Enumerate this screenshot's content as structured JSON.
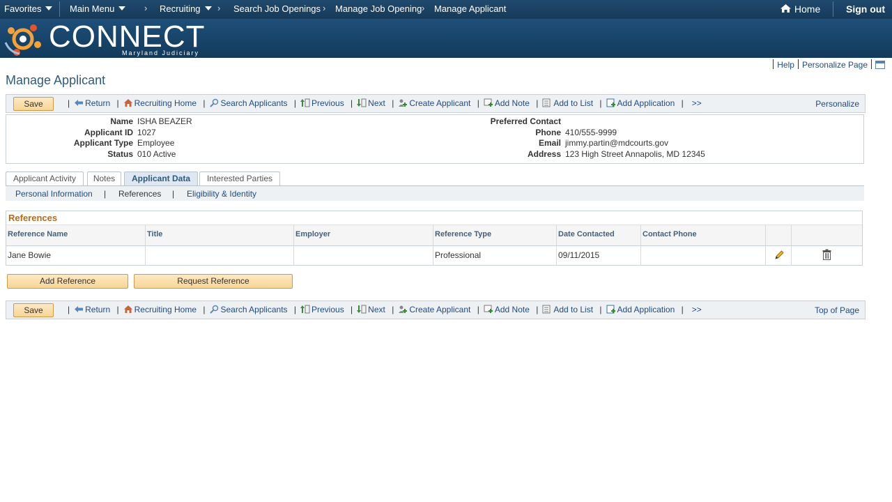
{
  "topnav": {
    "favorites": "Favorites",
    "main_menu": "Main Menu",
    "breadcrumbs": [
      "Recruiting",
      "Search Job Openings",
      "Manage Job Opening",
      "Manage Applicant"
    ],
    "home": "Home",
    "sign_out": "Sign out"
  },
  "banner": {
    "logo_text": "CONNECT",
    "logo_sub": "Maryland Judiciary"
  },
  "header_links": {
    "help": "Help",
    "personalize_page": "Personalize Page"
  },
  "page_title": "Manage Applicant",
  "toolbar": {
    "save": "Save",
    "items": [
      "Return",
      "Recruiting Home",
      "Search Applicants",
      "Previous",
      "Next",
      "Create Applicant",
      "Add Note",
      "Add to List",
      "Add Application",
      ">>"
    ],
    "personalize": "Personalize",
    "top_of_page": "Top of Page"
  },
  "applicant": {
    "labels": {
      "name": "Name",
      "id": "Applicant ID",
      "type": "Applicant Type",
      "status": "Status",
      "preferred": "Preferred Contact",
      "phone": "Phone",
      "email": "Email",
      "address": "Address"
    },
    "name": "ISHA BEAZER",
    "id": "1027",
    "type": "Employee",
    "status": "010 Active",
    "phone": "410/555-9999",
    "email": "jimmy.partin@mdcourts.gov",
    "address": "123 High Street Annapolis, MD 12345"
  },
  "tabs": [
    "Applicant Activity",
    "Notes",
    "Applicant Data",
    "Interested Parties"
  ],
  "subnav": {
    "personal": "Personal Information",
    "sep": "|",
    "references": "References",
    "eligibility": "Eligibility & Identity"
  },
  "references": {
    "title": "References",
    "columns": [
      "Reference Name",
      "Title",
      "Employer",
      "Reference Type",
      "Date Contacted",
      "Contact Phone"
    ],
    "rows": [
      {
        "name": "Jane Bowie",
        "title": "",
        "employer": "",
        "type": "Professional",
        "date": "09/11/2015",
        "phone": ""
      }
    ]
  },
  "buttons": {
    "add_reference": "Add Reference",
    "request_reference": "Request Reference"
  },
  "colors": {
    "nav": "#163a59",
    "banner": "#1e4f79",
    "link": "#1f4a80",
    "button": "#f8d594",
    "section_title": "#b36b1f"
  }
}
